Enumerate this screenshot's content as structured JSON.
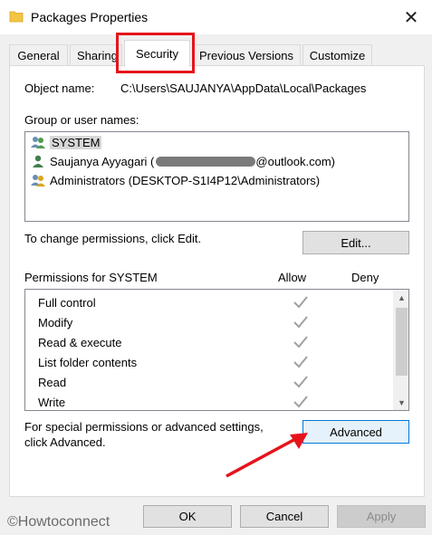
{
  "window": {
    "title": "Packages Properties",
    "close_glyph": "✕"
  },
  "tabs": [
    {
      "label": "General"
    },
    {
      "label": "Sharing"
    },
    {
      "label": "Security",
      "active": true
    },
    {
      "label": "Previous Versions"
    },
    {
      "label": "Customize"
    }
  ],
  "security": {
    "object_name_label": "Object name:",
    "object_name_value": "C:\\Users\\SAUJANYA\\AppData\\Local\\Packages",
    "group_label": "Group or user names:",
    "users": [
      {
        "name": "SYSTEM",
        "icon": "users-group-icon",
        "selected": true
      },
      {
        "name": "Saujanya Ayyagari (",
        "email_suffix": "@outlook.com)",
        "icon": "user-icon"
      },
      {
        "name": "Administrators (DESKTOP-S1I4P12\\Administrators)",
        "icon": "users-group-icon"
      }
    ],
    "change_text": "To change permissions, click Edit.",
    "edit_button": "Edit...",
    "permissions_label": "Permissions for SYSTEM",
    "allow_header": "Allow",
    "deny_header": "Deny",
    "permissions": [
      {
        "name": "Full control",
        "allow": true,
        "deny": false
      },
      {
        "name": "Modify",
        "allow": true,
        "deny": false
      },
      {
        "name": "Read & execute",
        "allow": true,
        "deny": false
      },
      {
        "name": "List folder contents",
        "allow": true,
        "deny": false
      },
      {
        "name": "Read",
        "allow": true,
        "deny": false
      },
      {
        "name": "Write",
        "allow": true,
        "deny": false
      }
    ],
    "special_text_1": "For special permissions or advanced settings,",
    "special_text_2": "click Advanced.",
    "advanced_button": "Advanced"
  },
  "footer": {
    "ok": "OK",
    "cancel": "Cancel",
    "apply": "Apply"
  },
  "watermark": "©Howtoconnect",
  "colors": {
    "highlight_red": "#e5141b",
    "focus_blue": "#0078d7",
    "check_gray": "#a0a0a0"
  }
}
